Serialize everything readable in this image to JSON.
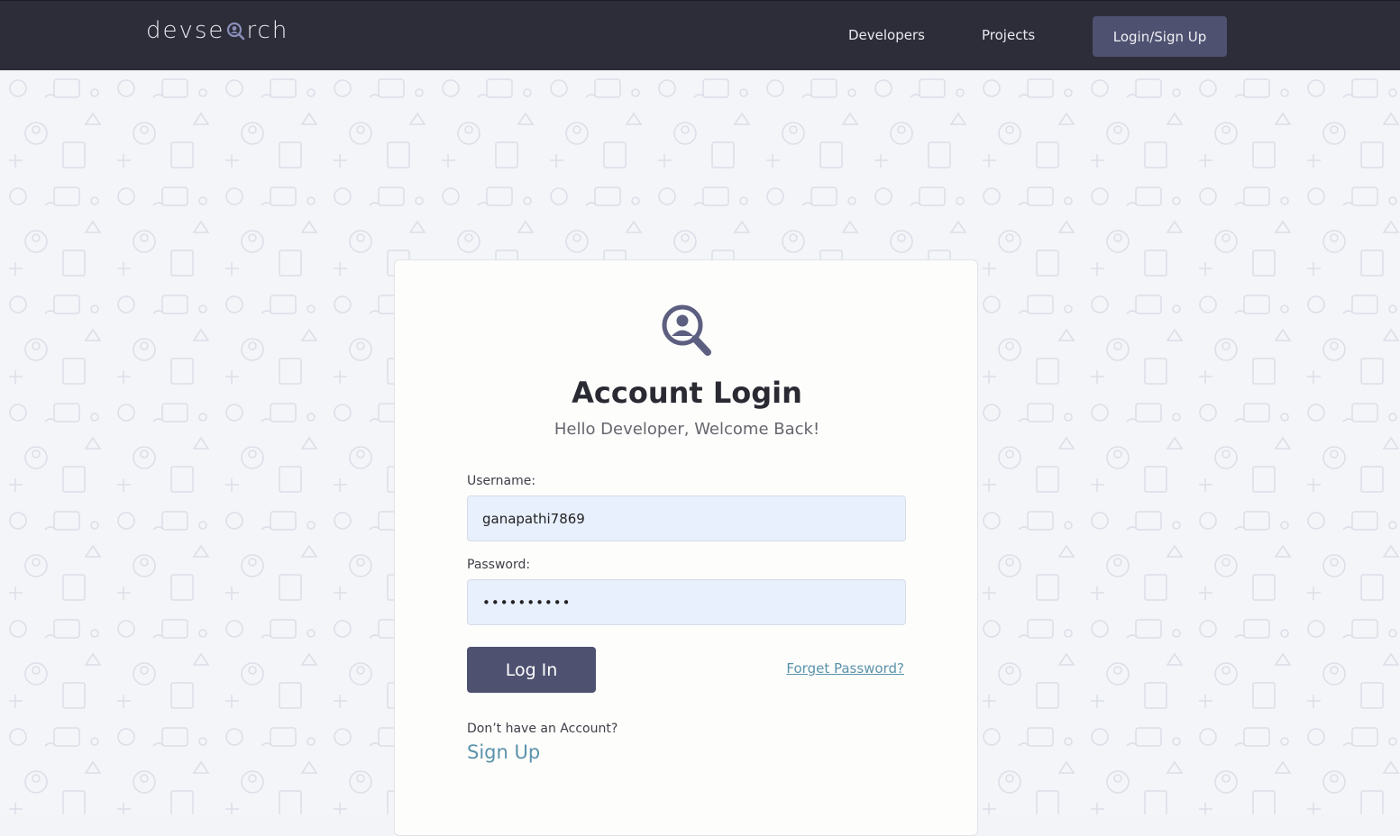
{
  "navbar": {
    "logo_text_left": "devse",
    "logo_text_right": "rch",
    "links": [
      "Developers",
      "Projects"
    ],
    "cta_label": "Login/Sign Up"
  },
  "login": {
    "title": "Account Login",
    "subtitle": "Hello Developer, Welcome Back!",
    "username_label": "Username:",
    "username_value": "ganapathi7869",
    "password_label": "Password:",
    "password_value": "••••••••••",
    "login_button": "Log In",
    "forgot_link": "Forget Password?",
    "no_account_text": "Don’t have an Account?",
    "signup_link": "Sign Up"
  },
  "icons": {
    "logo": "magnifier-user-icon",
    "card": "magnifier-user-icon"
  },
  "colors": {
    "navbar_bg": "#2d2d3a",
    "accent": "#4e5170",
    "link": "#5b93ab",
    "input_bg": "#e8f0fe"
  }
}
